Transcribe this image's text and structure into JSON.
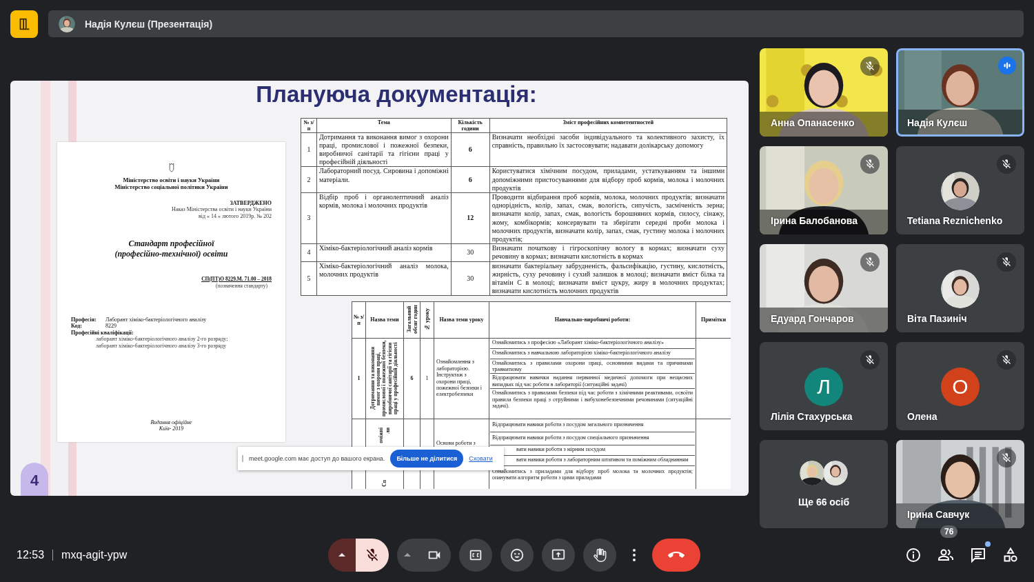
{
  "top_bar": {
    "presenter": "Надія Кулєш (Презентація)"
  },
  "slide": {
    "title": "Плануюча документація:",
    "page_number": "4",
    "document": {
      "ministries": [
        "Міністерство освіти і науки України",
        "Міністерство соціальної політики України"
      ],
      "approved": "ЗАТВЕРДЖЕНО",
      "order": [
        "Наказ Міністерства освіти і науки України",
        "від « 14 » лютого 2019р. № 202"
      ],
      "title": [
        "Стандарт професійної",
        "(професійно-технічної) освіти"
      ],
      "code": "СП(ПТ)О 8229.М. 71.00 – 2018",
      "code_caption": "(позначення стандарту)",
      "fields": [
        {
          "label": "Професія:",
          "value": "Лаборант хіміко-бактеріологічного аналізу"
        },
        {
          "label": "Код:",
          "value": "8229"
        }
      ],
      "qualifications_label": "Професійні кваліфікації:",
      "qualifications": [
        "лаборант хіміко-бактеріологічного аналізу 2-го розряду;",
        "лаборант хіміко-бактеріологічного аналізу 3-го розряду"
      ],
      "footer": [
        "Видання офіційне",
        "Київ- 2019"
      ]
    },
    "competency_table": {
      "columns": [
        "№ з/п",
        "Тема",
        "Кількість години",
        "Зміст професійних компетентностей"
      ],
      "rows": [
        {
          "number": "1",
          "topic": "Дотримання та виконання вимог з охорони праці, промислової і пожежної безпеки, виробничої санітарії та гігієни праці у професійній діяльності",
          "hours": "6",
          "emphasized": true,
          "content": "Визначати необхідні засоби індивідуального та колективного захисту, їх справність, правильно їх застосовувати; надавати долікарську допомогу"
        },
        {
          "number": "2",
          "topic": "Лабораторний посуд. Сировина і допоміжні матеріали.",
          "hours": "6",
          "emphasized": true,
          "content": "Користуватися хімічним посудом, приладами, устаткуванням та іншими допоміжними пристосуваннями для відбору проб кормів, молока і молочних продуктів"
        },
        {
          "number": "3",
          "topic": "Відбір проб і органолептичний аналіз кормів, молока і молочних продуктів",
          "hours": "12",
          "emphasized": true,
          "content": "Проводити відбирання проб кормів, молока, молочних продуктів; визначати однорідність, колір, запах, смак, вологість, сипучість, засміченість зерна; визначати колір, запах, смак, вологість борошняних кормів, силосу, сінажу, жому, комбікормів; консервувати та зберігати середні проби молока і молочних продуктів, визначати колір, запах, смак, густину молока і молочних продуктів;"
        },
        {
          "number": "4",
          "topic": "Хіміко-бактеріологічний аналіз кормів",
          "hours": "30",
          "emphasized": false,
          "content": "Визначати початкову і гігроскопічну вологу в кормах; визначати суху речовину в кормах; визначати кислотність в кормах"
        },
        {
          "number": "5",
          "topic": "Хіміко-бактеріологічний аналіз молока, молочних продуктів",
          "hours": "30",
          "emphasized": false,
          "content": "визначати бактеріальну забрудненість, фальсифікацію, густину, кислотність, жирність, суху речовину і сухий залишок в молоці; визначати вміст білка та вітамін С в молоці; визначати вміст цукру, жиру в молочних продуктах; визначати кислотність молочних продуктів"
        }
      ]
    },
    "lesson_table": {
      "columns": [
        {
          "label": "№ з/п",
          "vertical": false
        },
        {
          "label": "Назва теми",
          "vertical": false
        },
        {
          "label": "Загальний обсяг годин",
          "vertical": true
        },
        {
          "label": "№ уроку",
          "vertical": true
        },
        {
          "label": "Назва теми уроку",
          "vertical": false
        },
        {
          "label": "Навчально-виробничі роботи:",
          "vertical": false
        },
        {
          "label": "Примітки",
          "vertical": false
        }
      ],
      "rows": [
        {
          "number": "1",
          "topic_fragments": [
            "Дотримання та виконання вимог з охорони праці, промислової і пожежної безпеки, виробничої санітарії та гігієни праці у професійній діяльності"
          ],
          "hours": "6",
          "lesson": "1",
          "lesson_title": "Ознайомлення з лабораторією. Інструктаж з охорони праці, пожежної безпеки і електробезпеки",
          "works": [
            {
              "text": "Ознайомитись з професією «Лаборант хіміко-бактеріологічного аналізу»",
              "covered": false
            },
            {
              "text": "Ознайомитись з навчальною лабораторією хіміко-бактеріологічного аналізу",
              "covered": false
            },
            {
              "text": "Ознайомитись з правилами охорони праці, основними видами та причинами травматизму",
              "covered": false
            },
            {
              "text": "Відпрацювати навички надання первинної медичної допомоги при нещасних випадках під час роботи в лабораторії (ситуаційні задачі)",
              "covered": false
            },
            {
              "text": "Ознайомитись з правилами безпеки під час роботи з хімічними реактивами, освоїти правила безпеки праці з отруйними і вибухонебезпечними речовинами (ситуаційні задачі).",
              "covered": false
            }
          ]
        },
        {
          "number": "",
          "topic_fragments": [
            "оміжні",
            "ли",
            "Сп"
          ],
          "hours": "",
          "lesson": "",
          "lesson_title": "Основи роботи з",
          "works": [
            {
              "text": "Відпрацювати навики роботи з посудом загального призначення",
              "covered": false
            },
            {
              "text": "Відпрацювати навики роботи з посудом спеціального призначення",
              "covered": false
            },
            {
              "text": "вати навики роботи з мірним посудом",
              "covered": true
            },
            {
              "text": "вати навики роботи з лабораторним штативом та поміжним обладнанням",
              "covered": true
            },
            {
              "text": "Ознайомитись з приладами для відбору проб молока та молочних продуктів; опанувати алгоритм роботи з цими приладами",
              "covered": false
            }
          ]
        }
      ]
    }
  },
  "share_notice": {
    "message": "meet.google.com має доступ до вашого екрана.",
    "stop_button": "Більше не ділитися",
    "hide_link": "Сховати"
  },
  "tiles": [
    {
      "name": "Анна Опанасенко",
      "kind": "video",
      "muted": true,
      "speaking": false
    },
    {
      "name": "Надія Кулєш",
      "kind": "video",
      "muted": false,
      "speaking": true
    },
    {
      "name": "Ірина Балобанова",
      "kind": "video",
      "muted": true,
      "speaking": false
    },
    {
      "name": "Tetiana Reznichenko",
      "kind": "avatar",
      "muted": true,
      "speaking": false
    },
    {
      "name": "Едуард Гончаров",
      "kind": "video",
      "muted": true,
      "speaking": false
    },
    {
      "name": "Віта Пазиніч",
      "kind": "avatar",
      "muted": true,
      "speaking": false
    },
    {
      "name": "Лілія Стахурська",
      "kind": "letter",
      "letter": "Л",
      "color": "#12867a",
      "muted": true,
      "speaking": false
    },
    {
      "name": "Олена",
      "kind": "letter",
      "letter": "О",
      "color": "#d1421a",
      "muted": true,
      "speaking": false
    },
    {
      "name": "Ще 66 осіб",
      "kind": "more",
      "muted": false,
      "speaking": false
    },
    {
      "name": "Ірина Савчук",
      "kind": "video",
      "muted": true,
      "speaking": false
    }
  ],
  "bottom_bar": {
    "time": "12:53",
    "meeting_code": "mxq-agit-ypw",
    "controls": [
      {
        "kind": "mic",
        "muted": true
      },
      {
        "kind": "camera",
        "on": true
      },
      {
        "kind": "captions"
      },
      {
        "kind": "reactions"
      },
      {
        "kind": "present"
      },
      {
        "kind": "hand"
      },
      {
        "kind": "more"
      },
      {
        "kind": "leave"
      }
    ],
    "side_buttons": [
      {
        "kind": "info"
      },
      {
        "kind": "people",
        "badge": "76"
      },
      {
        "kind": "chat",
        "unread": true
      },
      {
        "kind": "activities"
      }
    ]
  }
}
